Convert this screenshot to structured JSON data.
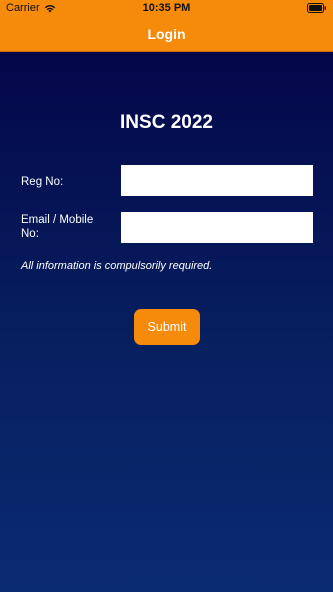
{
  "status_bar": {
    "carrier": "Carrier",
    "time": "10:35 PM",
    "wifi_icon": "wifi-icon",
    "battery_icon": "battery-icon"
  },
  "nav": {
    "title": "Login"
  },
  "main": {
    "title": "INSC 2022",
    "reg_label": "Reg No:",
    "reg_value": "",
    "email_label": "Email / Mobile No:",
    "email_value": "",
    "note": "All information is compulsorily required.",
    "submit_label": "Submit"
  },
  "colors": {
    "accent": "#f58a0b",
    "background_top": "#03074a",
    "background_bottom": "#0a2a72"
  }
}
